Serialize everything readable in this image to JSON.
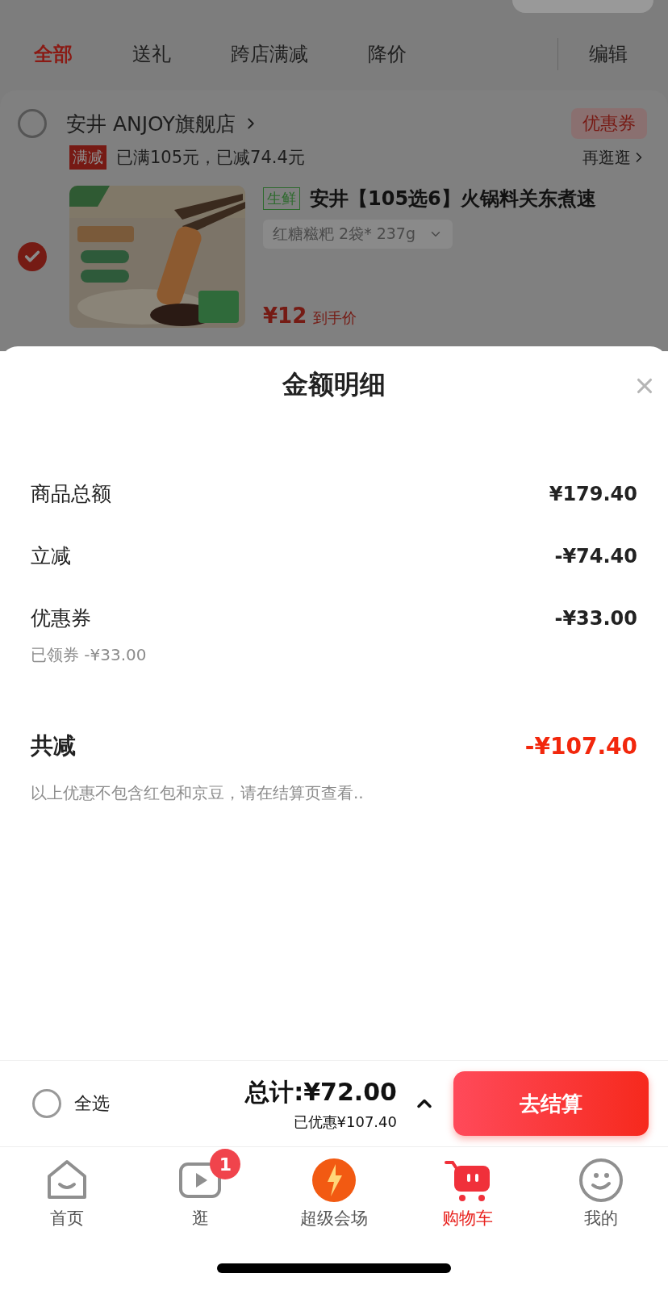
{
  "filter_tabs": [
    {
      "label": "全部",
      "selected": true
    },
    {
      "label": "送礼",
      "selected": false
    },
    {
      "label": "跨店满减",
      "selected": false
    },
    {
      "label": "降价",
      "selected": false
    }
  ],
  "edit_button": "编辑",
  "store": {
    "checked": false,
    "name": "安井 ANJOY旗舰店",
    "coupon_badge": "优惠券",
    "promo_tag": "满减",
    "promo_text": "已满105元，已减74.4元",
    "more_link": "再逛逛"
  },
  "product": {
    "checked": true,
    "tag": "生鲜",
    "title": "安井【105选6】火锅料关东煮速",
    "variant": "红糖糍粑 2袋* 237g",
    "price": "¥12",
    "price_label": "到手价"
  },
  "sheet": {
    "title": "金额明细",
    "rows": [
      {
        "kind": "line",
        "label": "商品总额",
        "value": "¥179.40"
      },
      {
        "kind": "line",
        "label": "立减",
        "value": "-¥74.40"
      },
      {
        "kind": "line",
        "label": "优惠券",
        "value": "-¥33.00",
        "note": "已领券 -¥33.00"
      },
      {
        "kind": "total",
        "label": "共减",
        "value": "-¥107.40",
        "note": "以上优惠不包含红包和京豆，请在结算页查看.."
      }
    ]
  },
  "footer": {
    "select_all": {
      "label": "全选",
      "checked": false
    },
    "total": "总计:¥72.00",
    "saved": "已优惠¥107.40",
    "checkout": "去结算"
  },
  "nav": [
    {
      "label": "首页",
      "selected": false
    },
    {
      "label": "逛",
      "selected": false,
      "badge": "1"
    },
    {
      "label": "超级会场",
      "selected": false
    },
    {
      "label": "购物车",
      "selected": true
    },
    {
      "label": "我的",
      "selected": false
    }
  ]
}
